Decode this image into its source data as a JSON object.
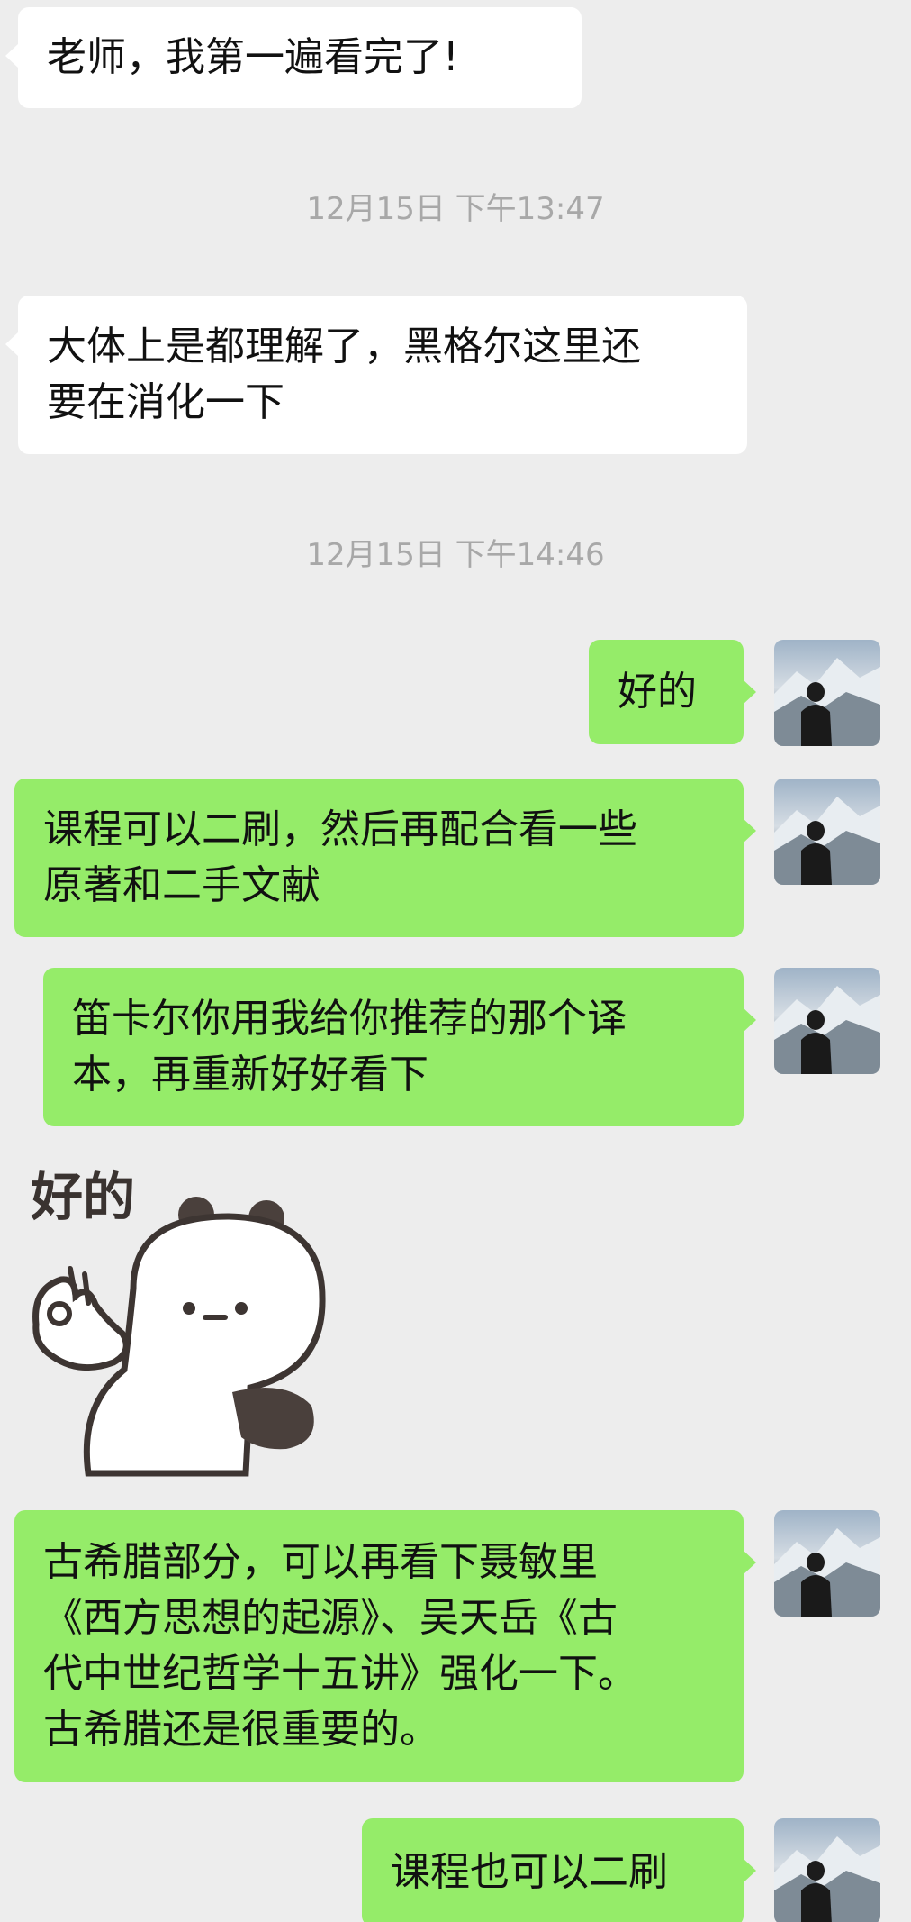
{
  "messages": [
    {
      "text": "老师，我第一遍看完了!"
    },
    {
      "text": "大体上是都理解了，黑格尔这里还\n要在消化一下"
    },
    {
      "text": "好的"
    },
    {
      "text": "课程可以二刷，然后再配合看一些\n原著和二手文献"
    },
    {
      "text": "笛卡尔你用我给你推荐的那个译\n本，再重新好好看下"
    },
    {
      "text": "古希腊部分，可以再看下聂敏里\n《西方思想的起源》、吴天岳《古\n代中世纪哲学十五讲》强化一下。\n古希腊还是很重要的。"
    },
    {
      "text": "课程也可以二刷"
    }
  ],
  "timestamps": [
    {
      "text": "12月15日 下午13:47"
    },
    {
      "text": "12月15日 下午14:46"
    }
  ],
  "sticker": {
    "caption": "好的",
    "icon": "panda-ok-sticker"
  },
  "colors": {
    "background": "#ededed",
    "incoming": "#ffffff",
    "outgoing": "#95ec69",
    "timestamp": "#a8a8a8"
  }
}
